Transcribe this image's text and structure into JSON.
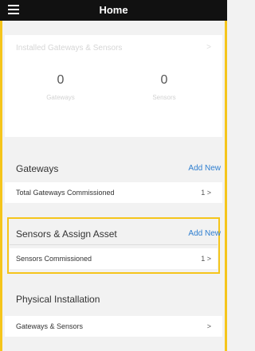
{
  "header": {
    "title": "Home"
  },
  "summary": {
    "title": "Installed Gateways & Sensors",
    "gateways": {
      "count": "0",
      "label": "Gateways"
    },
    "sensors": {
      "count": "0",
      "label": "Sensors"
    }
  },
  "gateways": {
    "title": "Gateways",
    "add_label": "Add New",
    "row": {
      "label": "Total Gateways Commissioned",
      "value": "1",
      "chevron": ">"
    }
  },
  "sensors": {
    "title": "Sensors & Assign Asset",
    "add_label": "Add New",
    "row": {
      "label": "Sensors Commissioned",
      "value": "1",
      "chevron": ">"
    }
  },
  "physical": {
    "title": "Physical Installation",
    "row": {
      "label": "Gateways & Sensors",
      "chevron": ">"
    }
  },
  "colors": {
    "accent": "#f5c51b",
    "link": "#2f7fd0",
    "appbar": "#111111"
  }
}
